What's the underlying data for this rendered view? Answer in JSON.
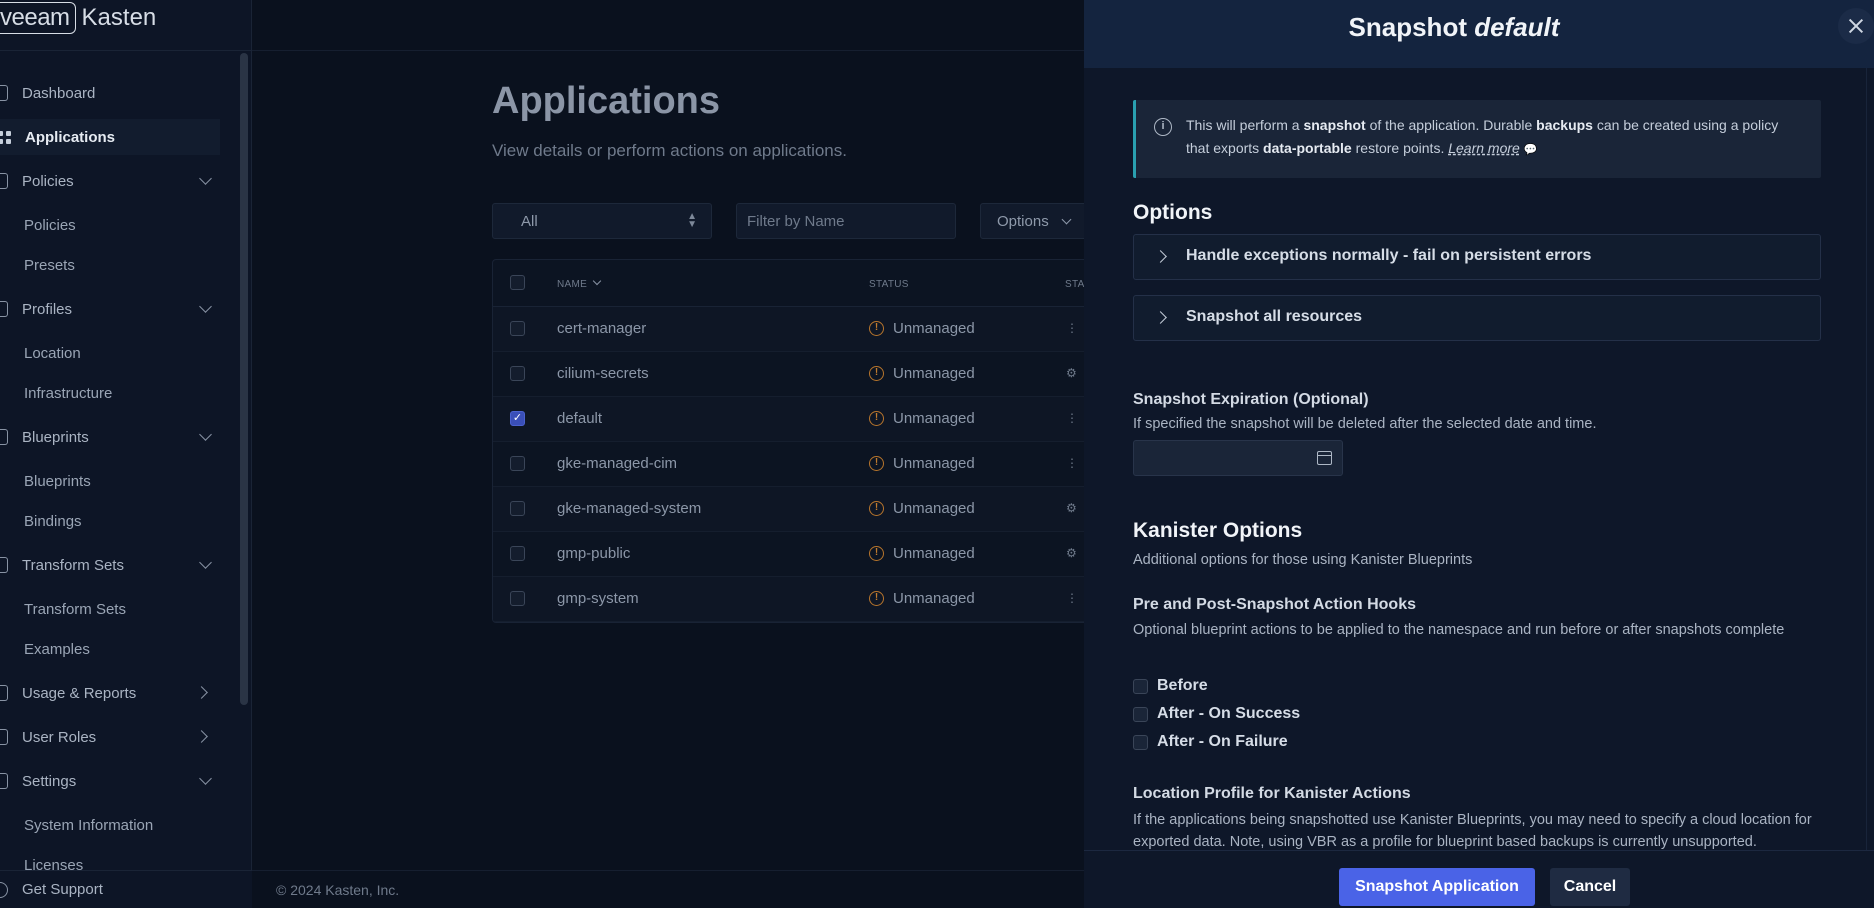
{
  "brand": {
    "part1": "veeam",
    "part2": "Kasten"
  },
  "sidebar": {
    "items": [
      {
        "label": "Dashboard"
      },
      {
        "label": "Applications"
      },
      {
        "label": "Policies"
      },
      {
        "label": "Policies"
      },
      {
        "label": "Presets"
      },
      {
        "label": "Profiles"
      },
      {
        "label": "Location"
      },
      {
        "label": "Infrastructure"
      },
      {
        "label": "Blueprints"
      },
      {
        "label": "Blueprints"
      },
      {
        "label": "Bindings"
      },
      {
        "label": "Transform Sets"
      },
      {
        "label": "Transform Sets"
      },
      {
        "label": "Examples"
      },
      {
        "label": "Usage & Reports"
      },
      {
        "label": "User Roles"
      },
      {
        "label": "Settings"
      },
      {
        "label": "System Information"
      },
      {
        "label": "Licenses"
      }
    ],
    "footer": "Get Support"
  },
  "main": {
    "title": "Applications",
    "subtitle": "View details or perform actions on applications.",
    "filter_select": "All",
    "filter_placeholder": "Filter by Name",
    "options_label": "Options",
    "table": {
      "headers": {
        "name": "NAME",
        "status": "STATUS",
        "status2": "STA"
      },
      "rows": [
        {
          "name": "cert-manager",
          "status": "Unmanaged",
          "checked": false
        },
        {
          "name": "cilium-secrets",
          "status": "Unmanaged",
          "checked": false
        },
        {
          "name": "default",
          "status": "Unmanaged",
          "checked": true
        },
        {
          "name": "gke-managed-cim",
          "status": "Unmanaged",
          "checked": false
        },
        {
          "name": "gke-managed-system",
          "status": "Unmanaged",
          "checked": false
        },
        {
          "name": "gmp-public",
          "status": "Unmanaged",
          "checked": false
        },
        {
          "name": "gmp-system",
          "status": "Unmanaged",
          "checked": false
        }
      ]
    },
    "footer": "© 2024 Kasten, Inc."
  },
  "drawer": {
    "title_prefix": "Snapshot",
    "title_app": "default",
    "info": {
      "t1": "This will perform a ",
      "b1": "snapshot",
      "t2": " of the application. Durable ",
      "b2": "backups",
      "t3": " can be created using a policy that exports ",
      "b3": "data-portable",
      "t4": " restore points. ",
      "learn_more": "Learn more"
    },
    "options_title": "Options",
    "accordions": [
      {
        "label": "Handle exceptions normally - fail on persistent errors"
      },
      {
        "label": "Snapshot all resources"
      }
    ],
    "expiration": {
      "label": "Snapshot Expiration (Optional)",
      "help": "If specified the snapshot will be deleted after the selected date and time."
    },
    "kanister": {
      "title": "Kanister Options",
      "subtitle": "Additional options for those using Kanister Blueprints"
    },
    "hooks": {
      "label": "Pre and Post-Snapshot Action Hooks",
      "help": "Optional blueprint actions to be applied to the namespace and run before or after snapshots complete",
      "options": [
        "Before",
        "After - On Success",
        "After - On Failure"
      ]
    },
    "location_profile": {
      "label": "Location Profile for Kanister Actions",
      "help": "If the applications being snapshotted use Kanister Blueprints, you may need to specify a cloud location for exported data. Note, using VBR as a profile for blueprint based backups is currently unsupported."
    },
    "buttons": {
      "primary": "Snapshot Application",
      "secondary": "Cancel"
    }
  }
}
